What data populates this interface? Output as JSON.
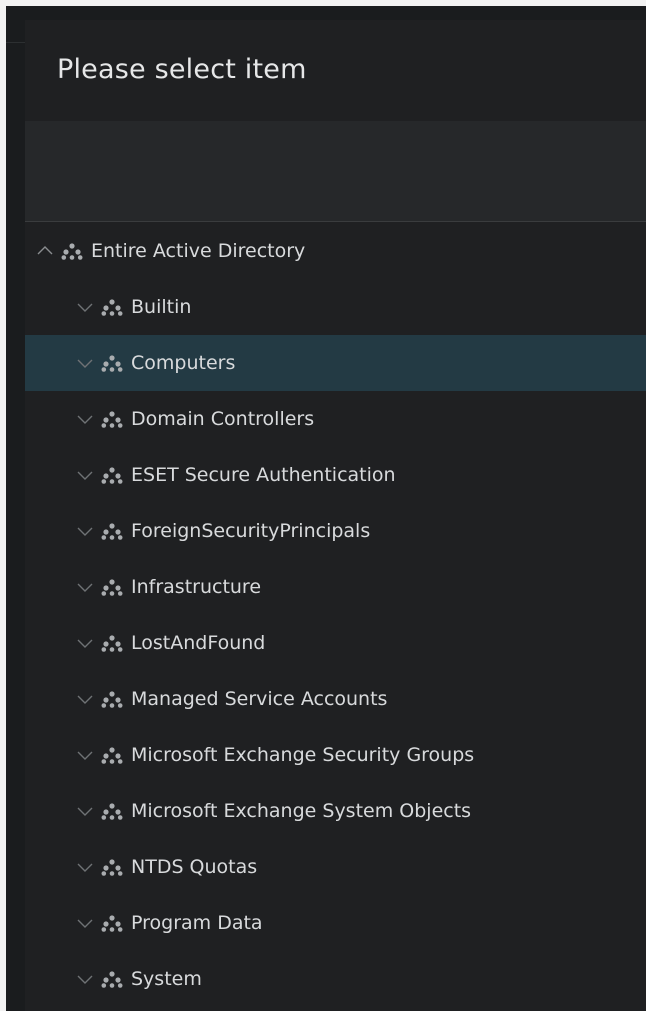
{
  "dialog": {
    "title": "Please select item"
  },
  "tree": {
    "root": {
      "label": "Entire Active Directory",
      "expanded": true,
      "icon": "org-unit-icon"
    },
    "children": [
      {
        "label": "Builtin",
        "selected": false
      },
      {
        "label": "Computers",
        "selected": true
      },
      {
        "label": "Domain Controllers",
        "selected": false
      },
      {
        "label": "ESET Secure Authentication",
        "selected": false
      },
      {
        "label": "ForeignSecurityPrincipals",
        "selected": false
      },
      {
        "label": "Infrastructure",
        "selected": false
      },
      {
        "label": "LostAndFound",
        "selected": false
      },
      {
        "label": "Managed Service Accounts",
        "selected": false
      },
      {
        "label": "Microsoft Exchange Security Groups",
        "selected": false
      },
      {
        "label": "Microsoft Exchange System Objects",
        "selected": false
      },
      {
        "label": "NTDS Quotas",
        "selected": false
      },
      {
        "label": "Program Data",
        "selected": false
      },
      {
        "label": "System",
        "selected": false
      }
    ]
  },
  "colors": {
    "background": "#1f2022",
    "selected_row": "#233a44",
    "text": "#d8dadc"
  }
}
